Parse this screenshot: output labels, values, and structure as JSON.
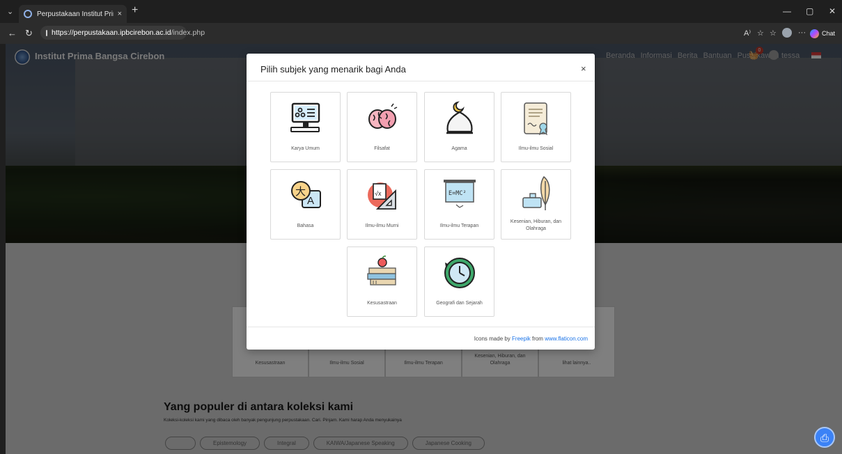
{
  "browser": {
    "tab_title": "Perpustakaan Institut Prima Bangsa",
    "tab_close": "×",
    "new_tab": "+",
    "url_host": "https://perpustakaan.ipbcirebon.ac.id",
    "url_path": "/index.php",
    "chat_label": "Chat"
  },
  "site": {
    "name": "Institut Prima Bangsa Cirebon",
    "nav": [
      "Beranda",
      "Informasi",
      "Berita",
      "Bantuan",
      "Pustakawan"
    ],
    "cart_count": "0",
    "user_name": "tessa"
  },
  "modal": {
    "title": "Pilih subjek yang menarik bagi Anda",
    "close": "×",
    "subjects": [
      {
        "label": "Karya Umum",
        "icon": "computer-icon"
      },
      {
        "label": "Filsafat",
        "icon": "brain-icon"
      },
      {
        "label": "Agama",
        "icon": "mosque-dome-icon"
      },
      {
        "label": "Ilmu-ilmu Sosial",
        "icon": "certificate-icon"
      },
      {
        "label": "Bahasa",
        "icon": "translate-icon"
      },
      {
        "label": "Ilmu-ilmu Murni",
        "icon": "math-icon"
      },
      {
        "label": "Ilmu-ilmu Terapan",
        "icon": "blackboard-icon"
      },
      {
        "label": "Kesenian, Hiburan, dan Olahraga",
        "icon": "ink-feather-icon"
      },
      {
        "label": "Kesusastraan",
        "icon": "books-apple-icon"
      },
      {
        "label": "Geografi dan Sejarah",
        "icon": "clock-icon"
      }
    ],
    "credit_prefix": "Icons made by",
    "credit_author": "Freepik",
    "credit_from": "from",
    "credit_site": "www.flaticon.com"
  },
  "background_categories": [
    "Kesusastraan",
    "Ilmu-ilmu Sosial",
    "Ilmu-ilmu Terapan",
    "Kesenian, Hiburan, dan Olahraga",
    "lihat lainnya.."
  ],
  "popular": {
    "title": "Yang populer di antara koleksi kami",
    "subtitle": "Koleksi-koleksi kami yang dibaca oleh banyak pengunjung perpustakaan. Cari. Pinjam. Kami harap Anda menyukainya",
    "chips": [
      "",
      "Epistemology",
      "Integral",
      "KAIWA/Japanese Speaking",
      "Japanese Cooking"
    ]
  }
}
